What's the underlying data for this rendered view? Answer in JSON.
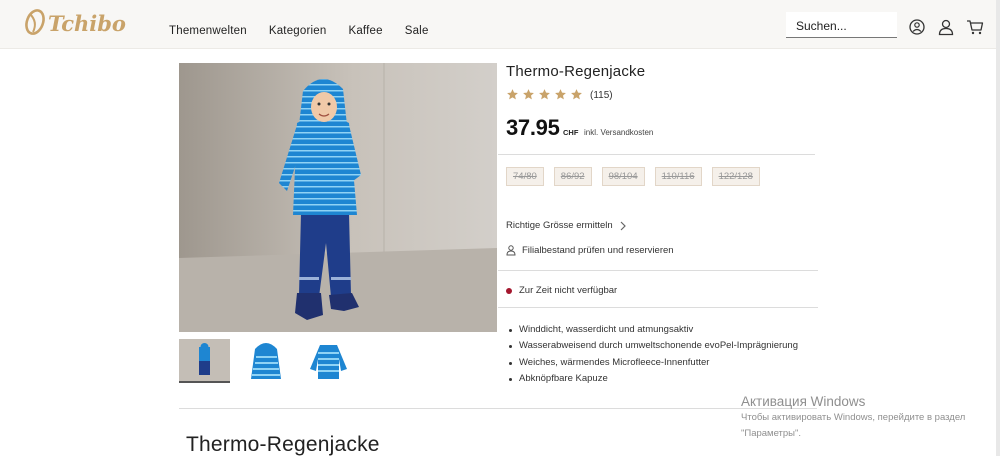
{
  "header": {
    "logo_text": "Tchibo",
    "nav": [
      "Themenwelten",
      "Kategorien",
      "Kaffee",
      "Sale"
    ],
    "search_placeholder": "Suchen...",
    "icons": [
      "store-locator-icon",
      "account-icon",
      "cart-icon"
    ]
  },
  "product": {
    "title": "Thermo-Regenjacke",
    "rating": {
      "stars": 5,
      "count": "(115)"
    },
    "price": "37.95",
    "currency": "CHF",
    "shipping": "inkl. Versandkosten",
    "sizes": [
      "74/80",
      "86/92",
      "98/104",
      "110/116",
      "122/128"
    ],
    "size_finder": "Richtige Grösse ermitteln",
    "store_check": "Filialbestand prüfen und reservieren",
    "availability": "Zur Zeit nicht verfügbar",
    "features": [
      "Winddicht, wasserdicht und atmungsaktiv",
      "Wasserabweisend durch umweltschonende evoPel-Imprägnierung",
      "Weiches, wärmendes Microfleece-Innenfutter",
      "Abknöpfbare Kapuze"
    ]
  },
  "section": {
    "title": "Thermo-Regenjacke"
  },
  "watermark": {
    "line1": "Активация Windows",
    "line2": "Чтобы активировать Windows, перейдите в раздел",
    "line3": "\"Параметры\"."
  },
  "colors": {
    "accent_gold": "#c9a36a",
    "unavailable_red": "#a4172e",
    "star": "#c9a36a",
    "jacket_blue": "#2f8fd6"
  }
}
